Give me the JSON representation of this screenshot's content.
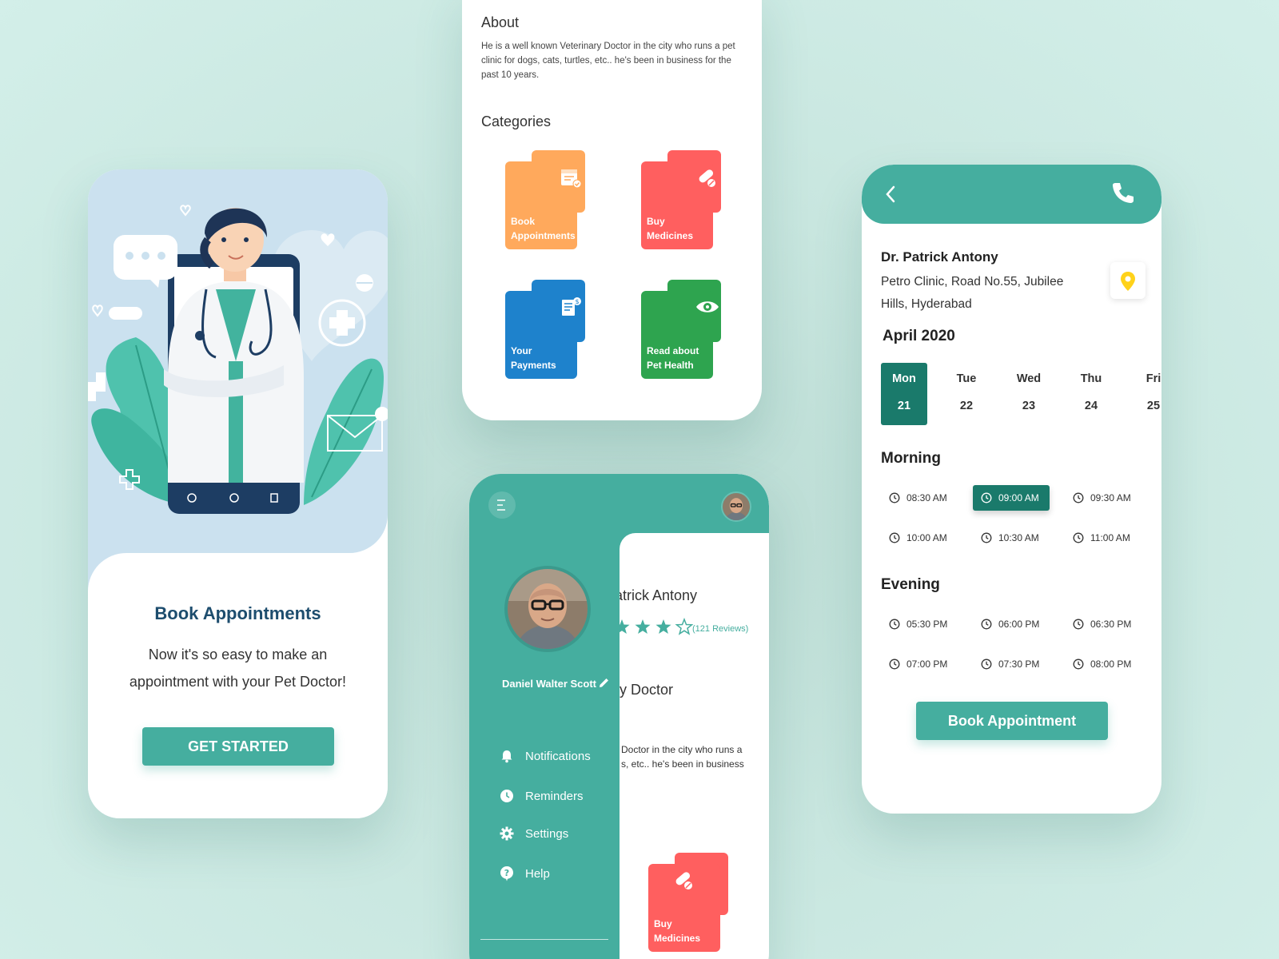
{
  "colors": {
    "primary": "#45ae9f",
    "selected": "#1a7a6b",
    "title": "#1d4d6e",
    "orange": "#ffa95c",
    "red": "#ff5f5f",
    "blue": "#1e82cc",
    "green": "#2ea44f"
  },
  "onboarding": {
    "title": "Book Appointments",
    "text": "Now it's so easy to make an appointment with your Pet Doctor!",
    "cta": "GET STARTED"
  },
  "profile": {
    "about_heading": "About",
    "about_text": "He is a well known Veterinary Doctor in the city who runs a pet clinic for dogs, cats, turtles, etc.. he's been in business for the past 10 years.",
    "categories_heading": "Categories",
    "categories": [
      {
        "label_1": "Book",
        "label_2": "Appointments",
        "icon": "calendar-check-icon",
        "color": "#ffa95c"
      },
      {
        "label_1": "Buy",
        "label_2": "Medicines",
        "icon": "pills-icon",
        "color": "#ff5f5f"
      },
      {
        "label_1": "Your",
        "label_2": "Payments",
        "icon": "receipt-icon",
        "color": "#1e82cc"
      },
      {
        "label_1": "Read about",
        "label_2": "Pet Health",
        "icon": "eye-icon",
        "color": "#2ea44f"
      }
    ]
  },
  "drawer": {
    "user_name": "Daniel Walter Scott",
    "menu": [
      {
        "label": "Notifications",
        "icon": "bell-icon"
      },
      {
        "label": "Reminders",
        "icon": "clock-icon"
      },
      {
        "label": "Settings",
        "icon": "gear-icon"
      },
      {
        "label": "Help",
        "icon": "help-icon"
      }
    ],
    "background": {
      "name_fragment": "atrick Antony",
      "reviews": "(121 Reviews)",
      "role_fragment": "ry Doctor",
      "about_line1": "Doctor in the city who runs a",
      "about_line2": "s, etc.. he's been in business",
      "tile_label_1": "Buy",
      "tile_label_2": "Medicines"
    }
  },
  "booking": {
    "doctor_name": "Dr. Patrick Antony",
    "address": "Petro Clinic, Road No.55, Jubilee Hills, Hyderabad",
    "month": "April 2020",
    "days": [
      {
        "name": "Mon",
        "date": "21"
      },
      {
        "name": "Tue",
        "date": "22"
      },
      {
        "name": "Wed",
        "date": "23"
      },
      {
        "name": "Thu",
        "date": "24"
      },
      {
        "name": "Fri",
        "date": "25"
      }
    ],
    "morning_label": "Morning",
    "morning": [
      "08:30 AM",
      "09:00 AM",
      "09:30 AM",
      "10:00 AM",
      "10:30 AM",
      "11:00 AM"
    ],
    "evening_label": "Evening",
    "evening": [
      "05:30 PM",
      "06:00 PM",
      "06:30 PM",
      "07:00 PM",
      "07:30 PM",
      "08:00 PM"
    ],
    "selected_day": "21",
    "selected_slot": "09:00 AM",
    "cta": "Book Appointment"
  }
}
